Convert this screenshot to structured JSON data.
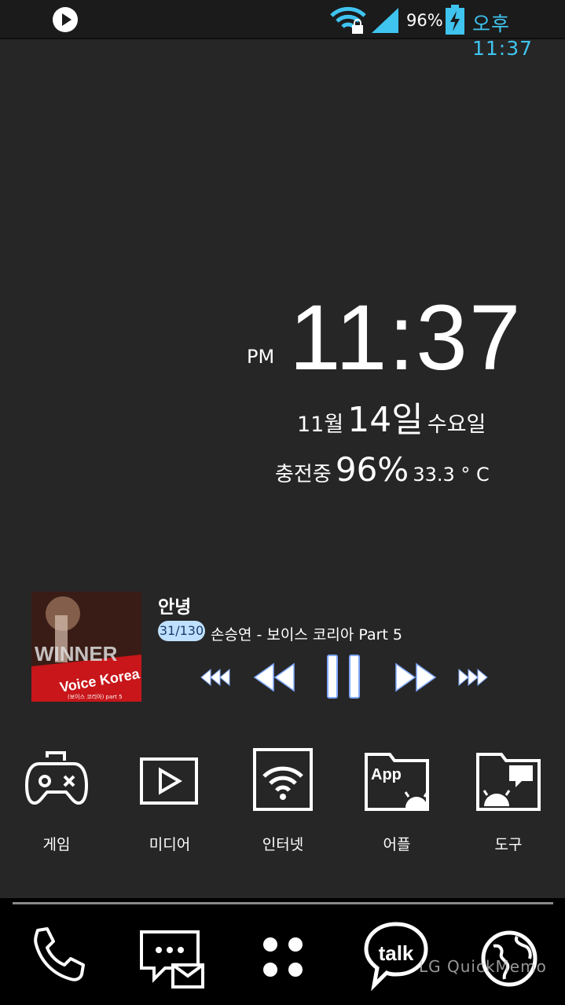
{
  "status_bar": {
    "battery_percent": "96%",
    "time": "오후 11:37",
    "accent": "#3fc4f0",
    "icons": [
      "media-play-icon",
      "wifi-lock-icon",
      "signal-icon",
      "battery-charging-icon"
    ]
  },
  "clock_widget": {
    "ampm": "PM",
    "time": "11:37",
    "month": "11월",
    "day": "14일",
    "weekday": "수요일",
    "charging_label": "충전중",
    "battery": "96%",
    "temperature": "33.3 ° C"
  },
  "music_widget": {
    "title": "안녕",
    "track": "31/130",
    "artist": "손승연 - 보이스 코리아 Part 5",
    "album_text": {
      "top": "WINNER",
      "show": "Voice Korea",
      "sub": "(보이스 코리아) part 5"
    },
    "controls": [
      "skip-previous-icon",
      "rewind-icon",
      "pause-icon",
      "fast-forward-icon",
      "skip-next-icon"
    ]
  },
  "apps": [
    {
      "label": "게임",
      "icon": "gamepad-icon"
    },
    {
      "label": "미디어",
      "icon": "media-play-box-icon"
    },
    {
      "label": "인터넷",
      "icon": "wifi-box-icon"
    },
    {
      "label": "어플",
      "icon": "app-folder-icon"
    },
    {
      "label": "도구",
      "icon": "tools-folder-icon"
    }
  ],
  "dock": {
    "icons": [
      "phone-icon",
      "messages-icon",
      "app-drawer-icon",
      "kakaotalk-icon",
      "browser-globe-icon"
    ],
    "talk_label": "talk",
    "watermark": "LG QuickMemo"
  }
}
